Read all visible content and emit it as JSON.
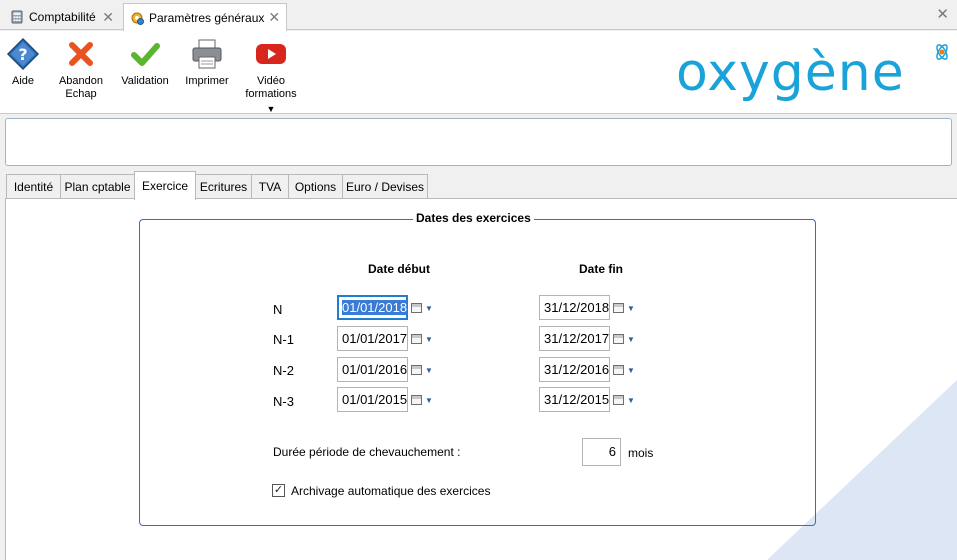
{
  "doc_tabs": [
    {
      "label": "Comptabilité",
      "icon": "calculator-icon"
    },
    {
      "label": "Paramètres généraux",
      "icon": "settings-gear-icon"
    }
  ],
  "toolbar": {
    "aide": "Aide",
    "abandon": "Abandon\nEchap",
    "validation": "Validation",
    "imprimer": "Imprimer",
    "video": "Vidéo\nformations"
  },
  "logo": {
    "text": "oxygène",
    "color": "#1aa3d8"
  },
  "tabs": [
    "Identité",
    "Plan cptable",
    "Exercice",
    "Ecritures",
    "TVA",
    "Options",
    "Euro / Devises"
  ],
  "active_tab": "Exercice",
  "group": {
    "title": "Dates des exercices",
    "col_debut": "Date début",
    "col_fin": "Date fin",
    "rows": [
      {
        "label": "N",
        "debut": "01/01/2018",
        "fin": "31/12/2018"
      },
      {
        "label": "N-1",
        "debut": "01/01/2017",
        "fin": "31/12/2017"
      },
      {
        "label": "N-2",
        "debut": "01/01/2016",
        "fin": "31/12/2016"
      },
      {
        "label": "N-3",
        "debut": "01/01/2015",
        "fin": "31/12/2015"
      }
    ],
    "overlap_label": "Durée période de chevauchement :",
    "overlap_value": "6",
    "overlap_unit": "mois",
    "archive_label": "Archivage automatique des exercices",
    "archive_checked": true
  },
  "colors": {
    "focus": "#1e7fd1",
    "group_border": "#3e6ea8",
    "accent_triangle": "#dde6f5"
  }
}
